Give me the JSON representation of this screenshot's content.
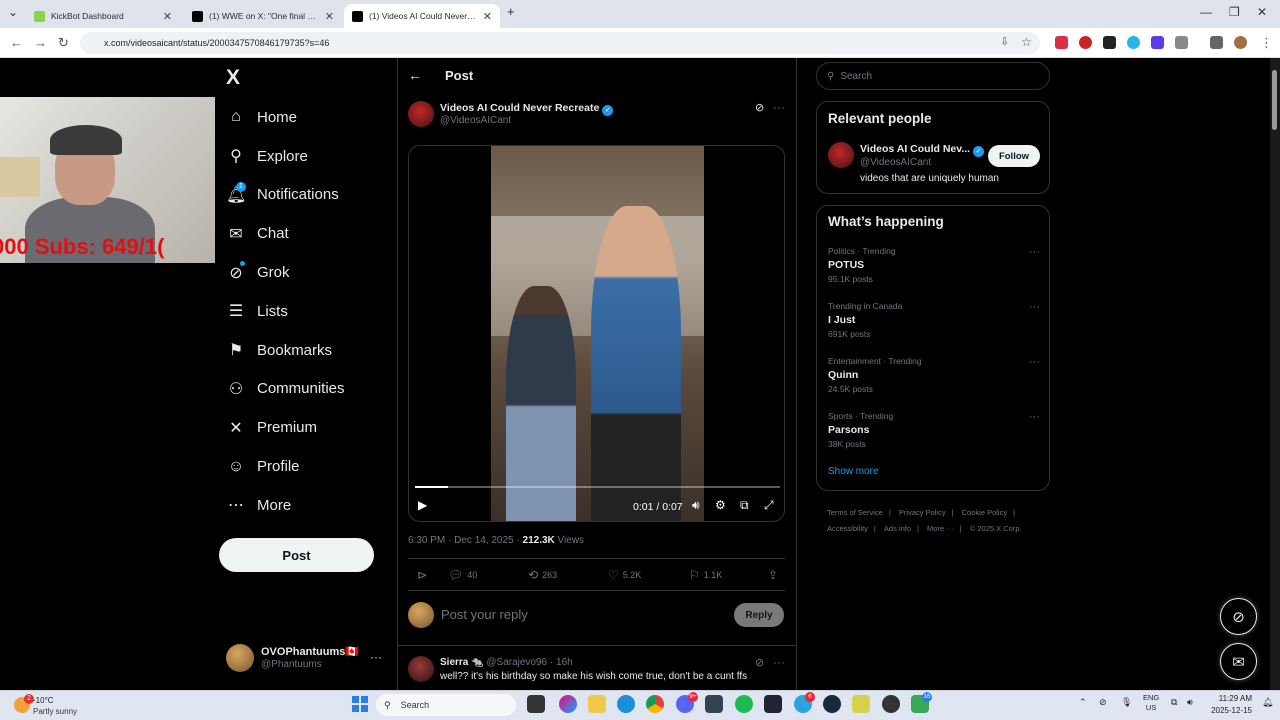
{
  "browser": {
    "tabs": [
      {
        "title": "KickBot Dashboard",
        "active": false
      },
      {
        "title": "(1) WWE on X: \"One final goodbye\"",
        "active": false
      },
      {
        "title": "(1) Videos AI Could Never Recreate",
        "active": true
      }
    ],
    "new_tab": "+",
    "url": "x.com/videosaicant/status/2000347570846179735?s=46"
  },
  "stream_overlay": {
    "ticker": "000 Subs: 649/1("
  },
  "sidebar": {
    "logo": "X",
    "items": [
      {
        "label": "Home",
        "icon": "home-icon",
        "glyph": "⌂"
      },
      {
        "label": "Explore",
        "icon": "search-icon",
        "glyph": "⚲"
      },
      {
        "label": "Notifications",
        "icon": "bell-icon",
        "glyph": "🔔︎",
        "badge": "1"
      },
      {
        "label": "Chat",
        "icon": "mail-icon",
        "glyph": "✉"
      },
      {
        "label": "Grok",
        "icon": "grok-icon",
        "glyph": "⊘"
      },
      {
        "label": "Lists",
        "icon": "list-icon",
        "glyph": "☰"
      },
      {
        "label": "Bookmarks",
        "icon": "bookmark-icon",
        "glyph": "⚑"
      },
      {
        "label": "Communities",
        "icon": "communities-icon",
        "glyph": "⚇"
      },
      {
        "label": "Premium",
        "icon": "x-premium-icon",
        "glyph": "✕"
      },
      {
        "label": "Profile",
        "icon": "profile-icon",
        "glyph": "☺"
      },
      {
        "label": "More",
        "icon": "more-circle-icon",
        "glyph": "⋯"
      }
    ],
    "post_label": "Post",
    "account": {
      "name": "OVOPhantuums",
      "flag": "🇨🇦",
      "handle": "@Phantuums",
      "more": "···"
    }
  },
  "post": {
    "header_title": "Post",
    "author_name": "Videos AI Could Never Recreate",
    "author_handle": "@VideosAICant",
    "video": {
      "time": "0:01 / 0:07",
      "progress": 0.09
    },
    "timestamp": "6:30 PM · Dec 14, 2025 · ",
    "views_count": "212.3K",
    "views_label": " Views",
    "actions": {
      "replies": "40",
      "reposts": "263",
      "likes": "5.2K",
      "bookmarks": "1.1K"
    },
    "reply_placeholder": "Post your reply",
    "reply_button": "Reply"
  },
  "comment": {
    "name": "Sierra 🐀",
    "handle": "@Sarajevo96 · 16h",
    "text": "well?? it's his birthday so make his wish come true, don't be a cunt ffs"
  },
  "right": {
    "search_placeholder": "Search",
    "relevant_title": "Relevant people",
    "person": {
      "name": "Videos AI Could Nev...",
      "handle": "@VideosAICant",
      "bio": "videos that are uniquely human",
      "follow": "Follow"
    },
    "happening_title": "What’s happening",
    "trends": [
      {
        "context": "Politics · Trending",
        "name": "POTUS",
        "posts": "95.1K posts"
      },
      {
        "context": "Trending in Canada",
        "name": "I Just",
        "posts": "691K posts"
      },
      {
        "context": "Entertainment · Trending",
        "name": "Quinn",
        "posts": "24.5K posts"
      },
      {
        "context": "Sports · Trending",
        "name": "Parsons",
        "posts": "38K posts"
      }
    ],
    "show_more": "Show more",
    "footer": {
      "terms": "Terms of Service",
      "privacy": "Privacy Policy",
      "cookie": "Cookie Policy",
      "access": "Accessibility",
      "ads": "Ads info",
      "more": "More ···",
      "copyright": "© 2025 X Corp."
    }
  },
  "taskbar": {
    "weather_temp": "-10°C",
    "weather_desc": "Partly sunny",
    "weather_badge": "2",
    "search": "Search",
    "lang_top": "ENG",
    "lang_bottom": "US",
    "time": "11:29 AM",
    "date": "2025-12-15",
    "badges": {
      "discord": "9+",
      "telegram": "6",
      "shield": "16"
    }
  },
  "colors": {
    "accent": "#1d9bf0",
    "bg": "#000000",
    "border": "#2f3336",
    "muted": "#71767b"
  }
}
